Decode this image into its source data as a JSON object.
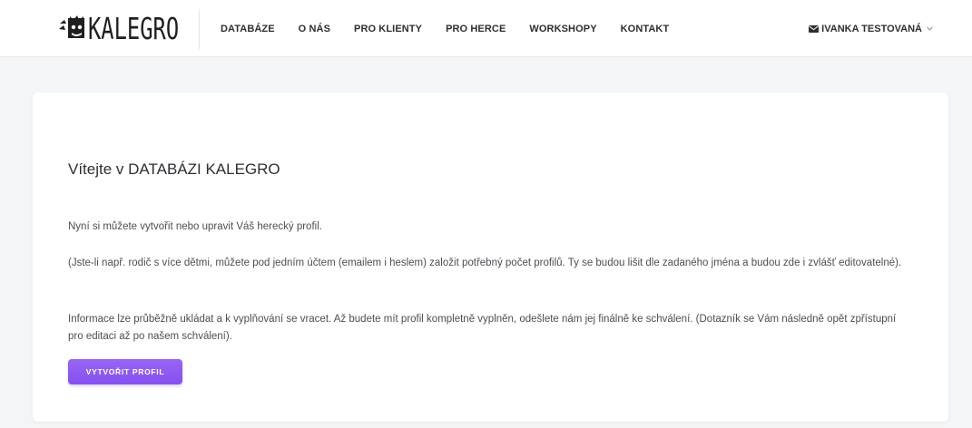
{
  "brand": {
    "name": "KALEGRO"
  },
  "nav": {
    "items": [
      {
        "label": "DATABÁZE"
      },
      {
        "label": "O NÁS"
      },
      {
        "label": "PRO KLIENTY"
      },
      {
        "label": "PRO HERCE"
      },
      {
        "label": "WORKSHOPY"
      },
      {
        "label": "KONTAKT"
      }
    ]
  },
  "user": {
    "name": "IVANKA TESTOVANÁ",
    "icon": "envelope-icon"
  },
  "main": {
    "title": "Vítejte v DATABÁZI KALEGRO",
    "paragraphs": [
      "Nyní si můžete vytvořit nebo upravit Váš herecký profil.",
      "(Jste-li např. rodič s více dětmi, můžete pod jedním účtem (emailem i heslem) založit potřebný počet profilů. Ty se budou lišit dle zadaného jména a budou zde i zvlášť editovatelné).",
      "Informace lze průběžně ukládat a k vyplňování se vracet. Až budete mít profil kompletně vyplněn, odešlete nám jej finálně ke schválení. (Dotazník se Vám následně opět zpřístupní pro editaci až po našem schválení)."
    ],
    "button_label": "VYTVOŘIT PROFIL"
  },
  "colors": {
    "accent": "#8b5cf6",
    "background": "#f4f5f7",
    "card": "#ffffff"
  }
}
